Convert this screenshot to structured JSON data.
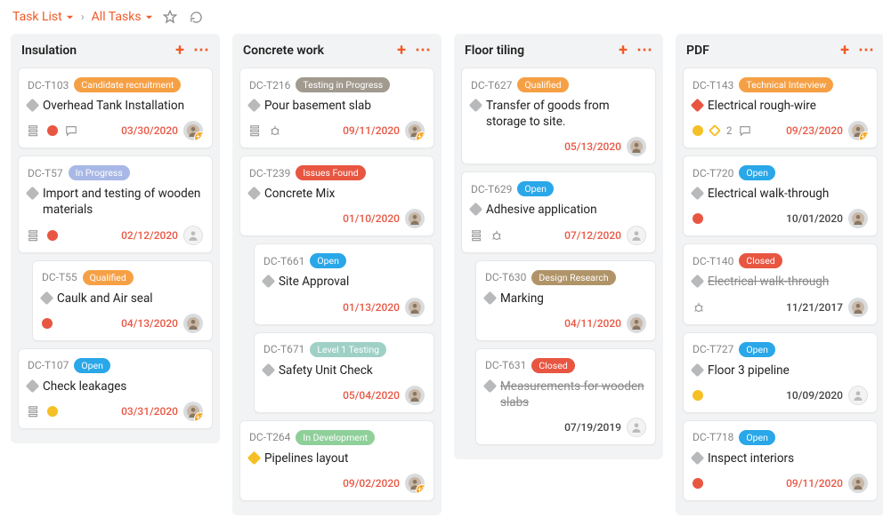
{
  "header": {
    "crumb1": "Task List",
    "crumb2": "All Tasks"
  },
  "statusColors": {
    "Candidate recruitment": "#f6a045",
    "In Progress": "#a8b8e6",
    "Qualified": "#f6a045",
    "Open": "#29a7e8",
    "Testing in Progress": "#a19a8e",
    "Issues Found": "#e85642",
    "Level 1 Testing": "#9fd0c6",
    "In Development": "#8fcf9a",
    "Design Research": "#b09468",
    "Closed": "#e85642",
    "Technical Interview": "#f6a045"
  },
  "columns": [
    {
      "title": "Insulation",
      "cards": [
        {
          "id": "DC-T103",
          "status": "Candidate recruitment",
          "title": "Overhead Tank Installation",
          "prio": "gray",
          "due": "03/30/2020",
          "dueColor": "red",
          "icons": [
            "subtask",
            "dot-red",
            "comment"
          ],
          "avatar": "user",
          "extra": 2
        },
        {
          "id": "DC-T57",
          "status": "In Progress",
          "title": "Import and testing of wooden materials",
          "prio": "gray",
          "due": "02/12/2020",
          "dueColor": "red",
          "icons": [
            "subtask",
            "dot-red"
          ],
          "avatar": "empty"
        },
        {
          "id": "DC-T55",
          "status": "Qualified",
          "title": "Caulk and Air seal",
          "prio": "gray",
          "due": "04/13/2020",
          "dueColor": "red",
          "icons": [
            "dot-red"
          ],
          "avatar": "user",
          "indented": true
        },
        {
          "id": "DC-T107",
          "status": "Open",
          "title": "Check leakages",
          "prio": "gray",
          "due": "03/31/2020",
          "dueColor": "red",
          "icons": [
            "subtask",
            "dot-yellow"
          ],
          "avatar": "user",
          "extra": 1
        }
      ]
    },
    {
      "title": "Concrete work",
      "cards": [
        {
          "id": "DC-T216",
          "status": "Testing in Progress",
          "title": "Pour basement slab",
          "prio": "gray",
          "due": "09/11/2020",
          "dueColor": "red",
          "icons": [
            "subtask",
            "bug"
          ],
          "avatar": "user",
          "extra": 3
        },
        {
          "id": "DC-T239",
          "status": "Issues Found",
          "title": "Concrete Mix",
          "prio": "gray",
          "due": "01/10/2020",
          "dueColor": "red",
          "icons": [],
          "avatar": "user"
        },
        {
          "id": "DC-T661",
          "status": "Open",
          "title": "Site Approval",
          "prio": "gray",
          "due": "01/13/2020",
          "dueColor": "red",
          "icons": [],
          "avatar": "user",
          "indented": true
        },
        {
          "id": "DC-T671",
          "status": "Level 1 Testing",
          "title": "Safety Unit Check",
          "prio": "gray",
          "due": "05/04/2020",
          "dueColor": "red",
          "icons": [],
          "avatar": "user",
          "indented": true
        },
        {
          "id": "DC-T264",
          "status": "In Development",
          "title": "Pipelines layout",
          "prio": "yellow",
          "due": "09/02/2020",
          "dueColor": "red",
          "icons": [],
          "avatar": "user",
          "extra": 2
        }
      ]
    },
    {
      "title": "Floor tiling",
      "cards": [
        {
          "id": "DC-T627",
          "status": "Qualified",
          "title": "Transfer of goods from storage to site.",
          "prio": "gray",
          "due": "05/13/2020",
          "dueColor": "red",
          "icons": [],
          "avatar": "user"
        },
        {
          "id": "DC-T629",
          "status": "Open",
          "title": "Adhesive application",
          "prio": "gray",
          "due": "07/12/2020",
          "dueColor": "red",
          "icons": [
            "subtask",
            "bug"
          ],
          "avatar": "empty"
        },
        {
          "id": "DC-T630",
          "status": "Design Research",
          "title": "Marking",
          "prio": "gray",
          "due": "04/11/2020",
          "dueColor": "red",
          "icons": [],
          "avatar": "user",
          "indented": true
        },
        {
          "id": "DC-T631",
          "status": "Closed",
          "title": "Measurements for wooden slabs",
          "prio": "gray",
          "strike": true,
          "due": "07/19/2019",
          "dueColor": "muted",
          "icons": [],
          "avatar": "empty",
          "indented": true
        }
      ]
    },
    {
      "title": "PDF",
      "cards": [
        {
          "id": "DC-T143",
          "status": "Technical Interview",
          "title": "Electrical rough-wire",
          "prio": "red",
          "due": "09/23/2020",
          "dueColor": "red",
          "icons": [
            "dot-yellow",
            "tag",
            "2",
            "comment"
          ],
          "avatar": "user",
          "extra": 1
        },
        {
          "id": "DC-T720",
          "status": "Open",
          "title": "Electrical walk-through",
          "prio": "gray",
          "due": "10/01/2020",
          "dueColor": "muted",
          "icons": [
            "dot-red"
          ],
          "avatar": "user"
        },
        {
          "id": "DC-T140",
          "status": "Closed",
          "title": "Electrical walk-through",
          "prio": "gray",
          "strike": true,
          "due": "11/21/2017",
          "dueColor": "muted",
          "icons": [
            "bug"
          ],
          "avatar": "user"
        },
        {
          "id": "DC-T727",
          "status": "Open",
          "title": "Floor 3 pipeline",
          "prio": "gray",
          "due": "10/09/2020",
          "dueColor": "muted",
          "icons": [
            "dot-yellow"
          ],
          "avatar": "empty"
        },
        {
          "id": "DC-T718",
          "status": "Open",
          "title": "Inspect interiors",
          "prio": "gray",
          "due": "09/11/2020",
          "dueColor": "red",
          "icons": [
            "dot-red"
          ],
          "avatar": "user"
        }
      ]
    }
  ]
}
